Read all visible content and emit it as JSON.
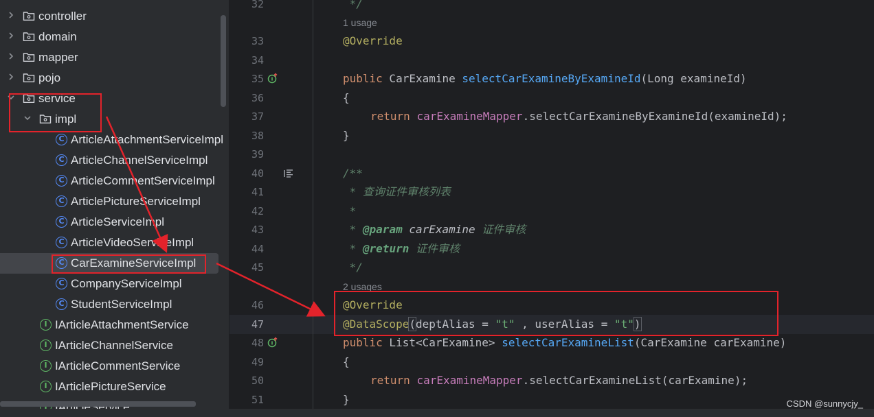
{
  "tree": {
    "items": [
      {
        "label": "controller",
        "type": "folder",
        "expanded": false
      },
      {
        "label": "domain",
        "type": "folder",
        "expanded": false
      },
      {
        "label": "mapper",
        "type": "folder",
        "expanded": false
      },
      {
        "label": "pojo",
        "type": "folder",
        "expanded": false
      },
      {
        "label": "service",
        "type": "folder",
        "expanded": true
      },
      {
        "label": "impl",
        "type": "folder",
        "expanded": true
      },
      {
        "label": "ArticleAttachmentServiceImpl",
        "type": "class"
      },
      {
        "label": "ArticleChannelServiceImpl",
        "type": "class"
      },
      {
        "label": "ArticleCommentServiceImpl",
        "type": "class"
      },
      {
        "label": "ArticlePictureServiceImpl",
        "type": "class"
      },
      {
        "label": "ArticleServiceImpl",
        "type": "class"
      },
      {
        "label": "ArticleVideoServiceImpl",
        "type": "class"
      },
      {
        "label": "CarExamineServiceImpl",
        "type": "class",
        "selected": true
      },
      {
        "label": "CompanyServiceImpl",
        "type": "class"
      },
      {
        "label": "StudentServiceImpl",
        "type": "class"
      },
      {
        "label": "IArticleAttachmentService",
        "type": "interface"
      },
      {
        "label": "IArticleChannelService",
        "type": "interface"
      },
      {
        "label": "IArticleCommentService",
        "type": "interface"
      },
      {
        "label": "IArticlePictureService",
        "type": "interface"
      },
      {
        "label": "IArticleService",
        "type": "interface"
      }
    ],
    "class_icon": "C",
    "interface_icon": "I"
  },
  "editor": {
    "line_numbers": [
      "32",
      "33",
      "34",
      "35",
      "36",
      "37",
      "38",
      "39",
      "40",
      "41",
      "42",
      "43",
      "44",
      "45",
      "46",
      "47",
      "48",
      "49",
      "50",
      "51"
    ],
    "hints": {
      "usage_1": "1 usage",
      "usage_2": "2 usages"
    },
    "code": {
      "l32": " */",
      "l33_ann": "@Override",
      "l35_kw": "public",
      "l35_type": " CarExamine ",
      "l35_fn": "selectCarExamineByExamineId",
      "l35_rest": "(Long examineId)",
      "l36": "{",
      "l37_kw": "return",
      "l37_fld": "carExamineMapper",
      "l37_rest": ".selectCarExamineByExamineId(examineId);",
      "l38": "}",
      "l40": "/**",
      "l41_star": " * ",
      "l41_text": "查询证件审核列表",
      "l42": " *",
      "l43_star": " * ",
      "l43_tag": "@param",
      "l43_name": " carExamine",
      "l43_text": " 证件审核",
      "l44_star": " * ",
      "l44_tag": "@return",
      "l44_text": " 证件审核",
      "l45": " */",
      "l46_ann": "@Override",
      "l47_ann": "@DataScope",
      "l47_open": "(",
      "l47_a": "deptAlias = ",
      "l47_s1": "\"t\"",
      "l47_b": " , userAlias = ",
      "l47_s2": "\"t\"",
      "l47_close": ")",
      "l48_kw": "public",
      "l48_type": " List<CarExamine> ",
      "l48_fn": "selectCarExamineList",
      "l48_rest": "(CarExamine carExamine)",
      "l49": "{",
      "l50_kw": "return",
      "l50_fld": "carExamineMapper",
      "l50_rest": ".selectCarExamineList(carExamine);",
      "l51": "}"
    }
  },
  "colors": {
    "annotation_box": "#e3232b",
    "keyword": "#cf8e6d",
    "annotation": "#b3ae60",
    "method": "#56a8f5",
    "field": "#c77dbb",
    "string": "#6aab73",
    "comment": "#5f826b"
  },
  "watermark": "CSDN @sunnycjy_"
}
